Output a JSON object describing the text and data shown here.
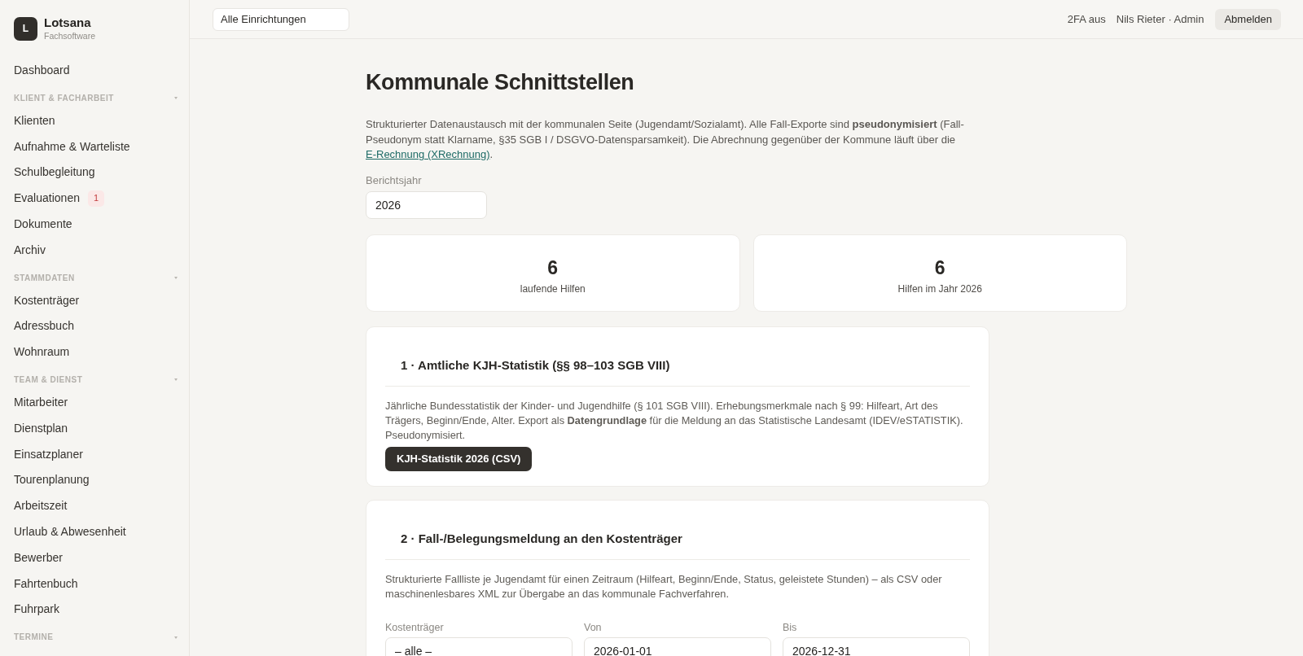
{
  "sidebar": {
    "brand": {
      "logo_letter": "L",
      "name": "Lotsana",
      "subtitle": "Fachsoftware"
    },
    "groups": [
      {
        "items": [
          {
            "label": "Dashboard",
            "selected": false
          }
        ]
      },
      {
        "heading": "KLIENT & FACHARBEIT",
        "items": [
          {
            "label": "Klienten",
            "selected": false
          },
          {
            "label": "Aufnahme & Warteliste",
            "selected": false
          },
          {
            "label": "Schulbegleitung",
            "selected": false
          },
          {
            "label": "Evaluationen",
            "badge": "1",
            "selected": false
          },
          {
            "label": "Dokumente",
            "selected": false
          },
          {
            "label": "Archiv",
            "selected": false
          }
        ]
      },
      {
        "heading": "STAMMDATEN",
        "items": [
          {
            "label": "Kostenträger",
            "selected": false
          },
          {
            "label": "Adressbuch",
            "selected": false
          },
          {
            "label": "Wohnraum",
            "selected": false
          }
        ]
      },
      {
        "heading": "TEAM & DIENST",
        "items": [
          {
            "label": "Mitarbeiter",
            "selected": false
          },
          {
            "label": "Dienstplan",
            "selected": false
          },
          {
            "label": "Einsatzplaner",
            "selected": false
          },
          {
            "label": "Tourenplanung",
            "selected": false
          },
          {
            "label": "Arbeitszeit",
            "selected": false
          },
          {
            "label": "Urlaub & Abwesenheit",
            "selected": false
          },
          {
            "label": "Bewerber",
            "selected": false
          },
          {
            "label": "Fahrtenbuch",
            "selected": false
          },
          {
            "label": "Fuhrpark",
            "selected": false
          }
        ]
      },
      {
        "heading": "TERMINE"
      }
    ]
  },
  "top_bar": {
    "facility_select": {
      "value": "Alle Einrichtungen"
    },
    "two_factor": "2FA aus",
    "user": "Nils Rieter · Admin",
    "logout_button": "Abmelden"
  },
  "page": {
    "title": "Kommunale Schnittstellen",
    "intro": {
      "text": "Strukturierter Datenaustausch mit der kommunalen Seite (Jugendamt/Sozialamt). Alle Fall-Exporte sind **pseudonymisiert** (Fall-Pseudonym statt Klarname, §35 SGB I / DSGVO-Datensparsamkeit). Die Abrechnung gegenüber der Kommune läuft über die ",
      "link": "E-Rechnung (XRechnung)",
      "text_after": "."
    },
    "report_year": {
      "label": "Berichtsjahr",
      "value": "2026"
    },
    "stats": [
      {
        "value": "6",
        "label": "laufende Hilfen"
      },
      {
        "value": "6",
        "label": "Hilfen im Jahr 2026"
      }
    ],
    "sections": [
      {
        "title": "1 · Amtliche KJH-Statistik (§§ 98–103 SGB VIII)",
        "description": "Jährliche Bundesstatistik der Kinder- und Jugendhilfe (§ 101 SGB VIII). Erhebungsmerkmale nach § 99: Hilfeart, Art des Trägers, Beginn/Ende, Alter. Export als **Datengrundlage** für die Meldung an das Statistische Landesamt (IDEV/eSTATISTIK). Pseudonymisiert.",
        "button": "KJH-Statistik 2026 (CSV)"
      },
      {
        "title": "2 · Fall-/Belegungsmeldung an den Kostenträger",
        "description": "Strukturierte Fallliste je Jugendamt für einen Zeitraum (Hilfeart, Beginn/Ende, Status, geleistete Stunden) – als CSV oder maschinenlesbares XML zur Übergabe an das kommunale Fachverfahren.",
        "fields": [
          {
            "label": "Kostenträger",
            "value": "– alle –"
          },
          {
            "label": "Von",
            "value": "2026-01-01"
          },
          {
            "label": "Bis",
            "value": "2026-12-31"
          }
        ]
      }
    ]
  }
}
